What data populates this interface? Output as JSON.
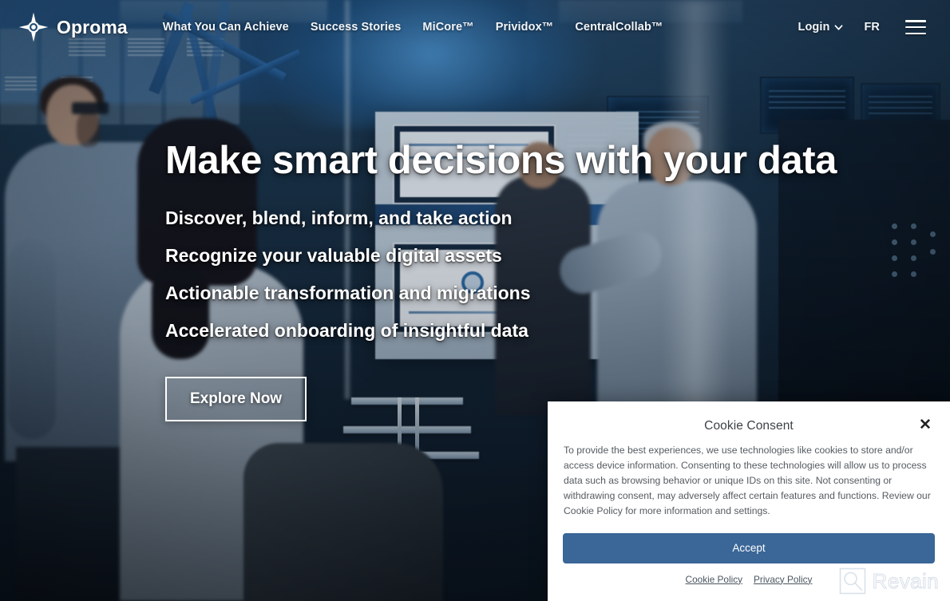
{
  "brand": {
    "name": "Oproma",
    "logo_icon": "compass-star-icon"
  },
  "nav": {
    "links": [
      {
        "label": "What You Can Achieve"
      },
      {
        "label": "Success Stories"
      },
      {
        "label": "MiCore™"
      },
      {
        "label": "Prividox™"
      },
      {
        "label": "CentralCollab™"
      }
    ],
    "login": {
      "label": "Login",
      "caret_icon": "chevron-down-icon"
    },
    "language": "FR",
    "menu_icon": "hamburger-menu-icon"
  },
  "hero": {
    "title": "Make smart decisions with your data",
    "subtitles": [
      "Discover, blend, inform, and take action",
      "Recognize your valuable digital assets",
      "Actionable transformation and migrations",
      "Accelerated onboarding of insightful data"
    ],
    "cta_label": "Explore Now"
  },
  "cookie_consent": {
    "title": "Cookie Consent",
    "close_icon": "close-icon",
    "body": "To provide the best experiences, we use technologies like cookies to store and/or access device information. Consenting to these technologies will allow us to process data such as browsing behavior or unique IDs on this site. Not consenting or withdrawing consent, may adversely affect certain features and functions. Review our Cookie Policy for more information and settings.",
    "accept_label": "Accept",
    "links": [
      {
        "label": "Cookie Policy"
      },
      {
        "label": "Privacy Policy"
      }
    ]
  },
  "watermark": {
    "text": "Revain",
    "icon": "magnifier-square-icon"
  },
  "colors": {
    "accept_button": "#3a6698",
    "text_on_hero": "#ffffff",
    "dialog_background": "#ffffff",
    "body_text": "#555b61"
  }
}
